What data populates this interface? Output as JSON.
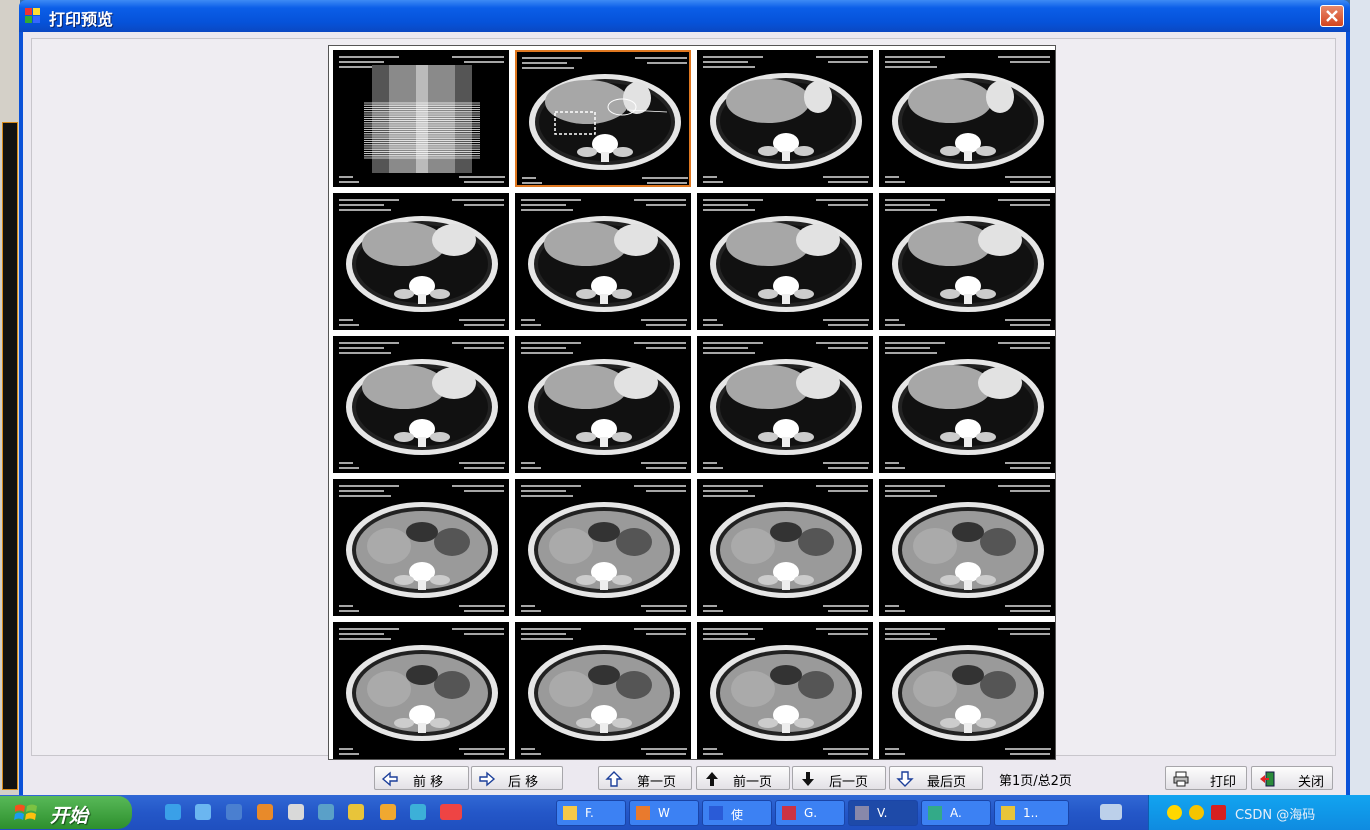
{
  "window": {
    "title": "打印预览"
  },
  "toolbar": {
    "shift_back": "前  移",
    "shift_forward": "后  移",
    "first_page": "第一页",
    "prev_page": "前一页",
    "next_page": "后一页",
    "last_page": "最后页",
    "page_info": "第1页/总2页",
    "print": "打印",
    "close": "关闭"
  },
  "sheet": {
    "columns": 4,
    "rows": 5,
    "selected_index": 1
  },
  "taskbar": {
    "start_label": "开始",
    "tasks": [
      {
        "label": "F."
      },
      {
        "label": "W"
      },
      {
        "label": "使"
      },
      {
        "label": "G."
      },
      {
        "label": "V."
      },
      {
        "label": "A."
      },
      {
        "label": "1.."
      }
    ],
    "active_task": 4
  },
  "tray": {
    "watermark": "CSDN @海码"
  }
}
